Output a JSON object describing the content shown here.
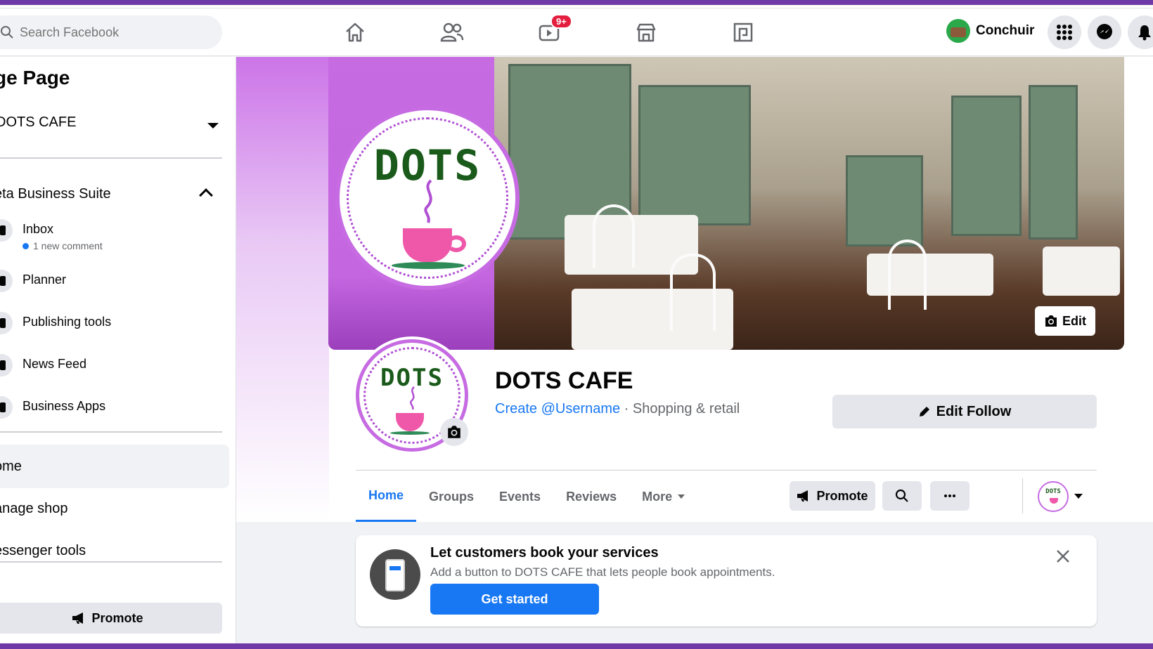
{
  "search": {
    "placeholder": "Search Facebook"
  },
  "nav": {
    "watch_badge": "9+"
  },
  "user": {
    "name": "Conchuir"
  },
  "sidebar": {
    "title": "ge Page",
    "page_select": "DOTS CAFE",
    "suite_label": "eta Business Suite",
    "items": [
      {
        "label": "Inbox",
        "sub": "1 new comment"
      },
      {
        "label": "Planner"
      },
      {
        "label": "Publishing tools"
      },
      {
        "label": "News Feed"
      },
      {
        "label": "Business Apps"
      }
    ],
    "links": [
      {
        "label": "ome"
      },
      {
        "label": "anage shop"
      },
      {
        "label": "essenger tools"
      }
    ],
    "promote_label": "Promote"
  },
  "cover": {
    "logo_text": "DOTS",
    "edit_label": "Edit"
  },
  "profile": {
    "logo_text": "DOTS",
    "page_name": "DOTS CAFE",
    "username_link": "Create @Username",
    "category": " · Shopping & retail",
    "edit_follow_label": "Edit Follow"
  },
  "tabs": [
    {
      "label": "Home"
    },
    {
      "label": "Groups"
    },
    {
      "label": "Events"
    },
    {
      "label": "Reviews"
    },
    {
      "label": "More"
    }
  ],
  "actions": {
    "promote_label": "Promote",
    "mini_logo_text": "DOTS"
  },
  "card": {
    "title": "Let customers book your services",
    "desc": "Add a button to DOTS CAFE that lets people book appointments.",
    "button_label": "Get started"
  },
  "colors": {
    "brand_blue": "#1877f2",
    "frame_purple": "#6f3aa7",
    "logo_purple": "#c66be2",
    "badge_red": "#e41e3f"
  }
}
